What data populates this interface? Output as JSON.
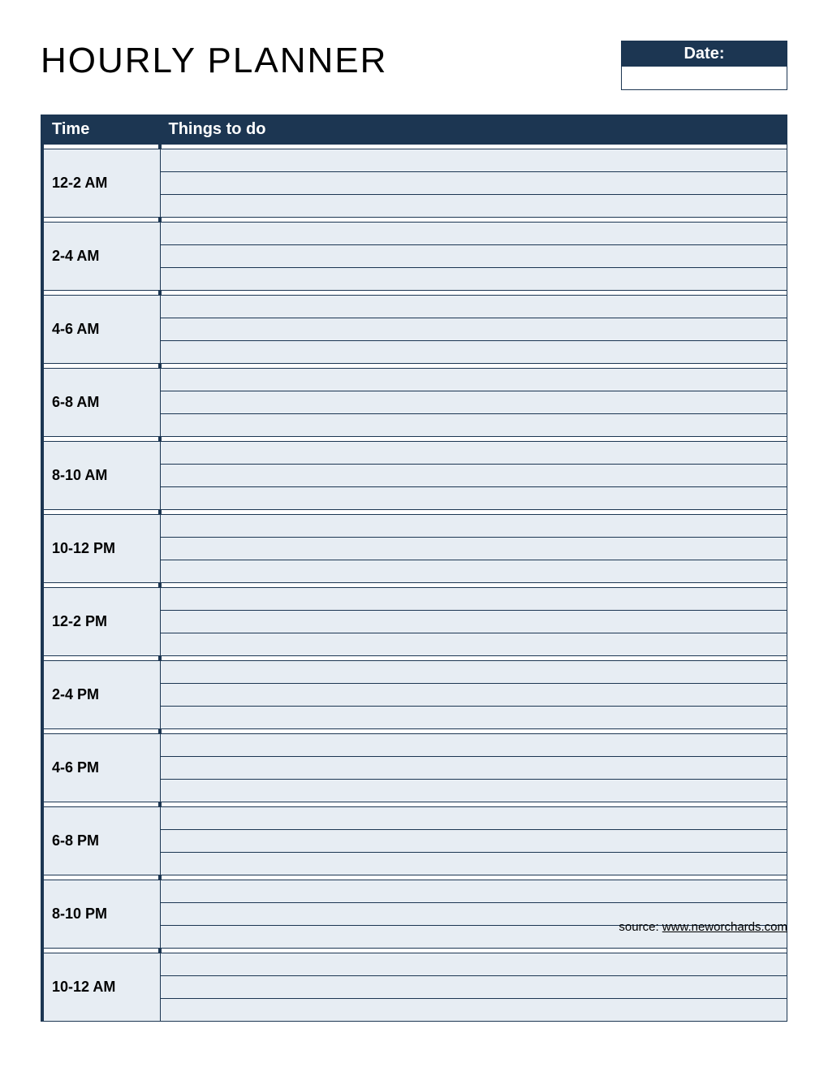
{
  "title": "HOURLY PLANNER",
  "date": {
    "label": "Date:",
    "value": ""
  },
  "columns": {
    "time": "Time",
    "todo": "Things to do"
  },
  "slots": [
    {
      "label": "12-2 AM",
      "todos": [
        "",
        "",
        ""
      ]
    },
    {
      "label": "2-4 AM",
      "todos": [
        "",
        "",
        ""
      ]
    },
    {
      "label": "4-6 AM",
      "todos": [
        "",
        "",
        ""
      ]
    },
    {
      "label": "6-8 AM",
      "todos": [
        "",
        "",
        ""
      ]
    },
    {
      "label": "8-10 AM",
      "todos": [
        "",
        "",
        ""
      ]
    },
    {
      "label": "10-12 PM",
      "todos": [
        "",
        "",
        ""
      ]
    },
    {
      "label": "12-2 PM",
      "todos": [
        "",
        "",
        ""
      ]
    },
    {
      "label": "2-4 PM",
      "todos": [
        "",
        "",
        ""
      ]
    },
    {
      "label": "4-6 PM",
      "todos": [
        "",
        "",
        ""
      ]
    },
    {
      "label": "6-8 PM",
      "todos": [
        "",
        "",
        ""
      ]
    },
    {
      "label": "8-10 PM",
      "todos": [
        "",
        "",
        ""
      ]
    },
    {
      "label": "10-12 AM",
      "todos": [
        "",
        "",
        ""
      ]
    }
  ],
  "footer": {
    "prefix": "source: ",
    "link_text": "www.neworchards.com"
  }
}
